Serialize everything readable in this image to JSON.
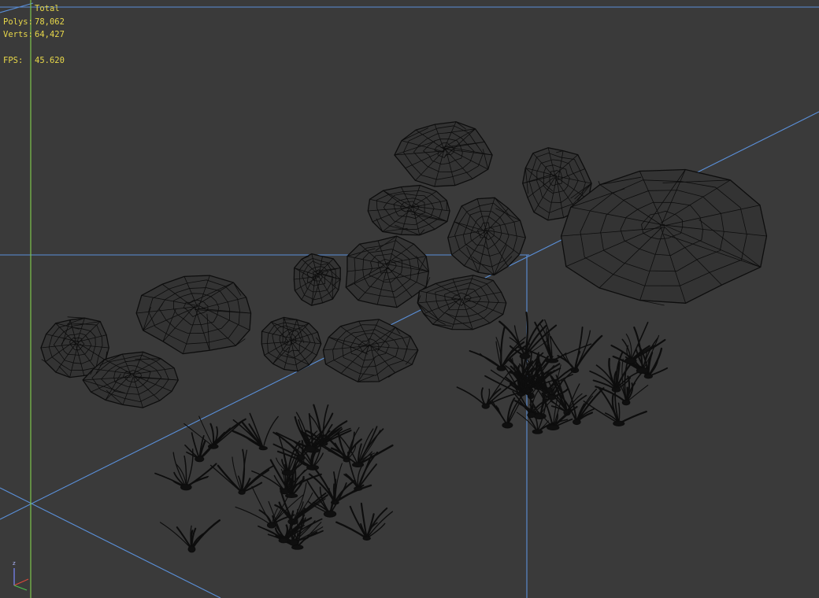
{
  "viewport": {
    "background": "#3a3a3a",
    "grid_line_color": "#5a8fd8",
    "wire_color": "#0d0d0d"
  },
  "stats": {
    "header": "Total",
    "polys_label": "Polys:",
    "polys_value": "78,062",
    "verts_label": "Verts:",
    "verts_value": "64,427",
    "fps_label": "FPS:",
    "fps_value": "45.620",
    "text_color": "#e8d84a"
  },
  "gizmo": {
    "z_label": "z"
  },
  "scene": {
    "rock_count": 14,
    "grass_patch_count": 2
  }
}
